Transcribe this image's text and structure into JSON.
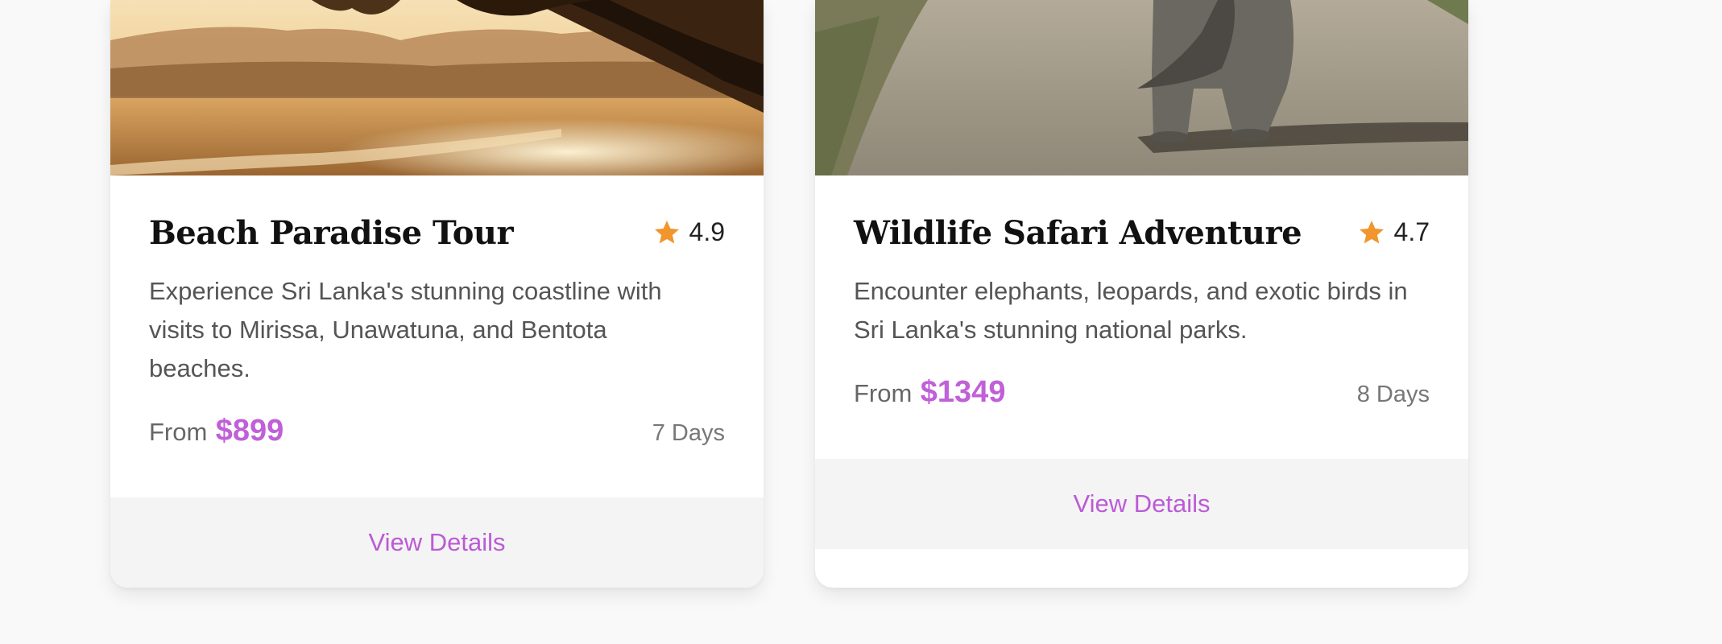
{
  "accent_color": "#c060d8",
  "star_color": "#f0962d",
  "tours": [
    {
      "title": "Beach Paradise Tour",
      "rating": "4.9",
      "description": "Experience Sri Lanka's stunning coastline with visits to Mirissa, Unawatuna, and Bentota beaches.",
      "from_label": "From",
      "price": "$899",
      "duration": "7 Days",
      "button_label": "View Details",
      "image_icon": "beach-sunset-photo"
    },
    {
      "title": "Wildlife Safari Adventure",
      "rating": "4.7",
      "description": "Encounter elephants, leopards, and exotic birds in Sri Lanka's stunning national parks.",
      "from_label": "From",
      "price": "$1349",
      "duration": "8 Days",
      "button_label": "View Details",
      "image_icon": "elephant-road-photo"
    }
  ]
}
